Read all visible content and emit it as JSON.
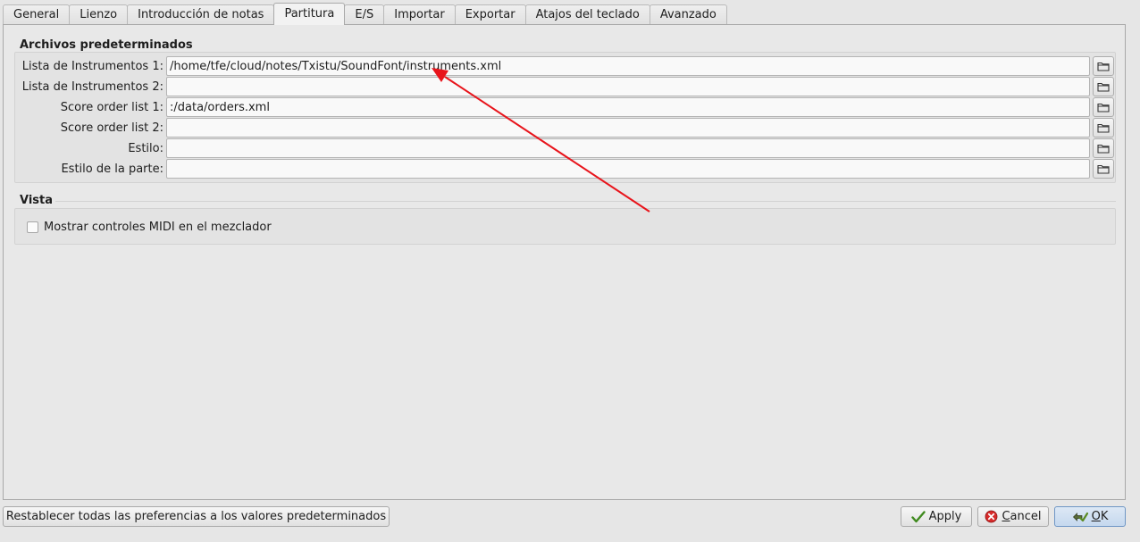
{
  "tabs": [
    {
      "label": "General"
    },
    {
      "label": "Lienzo"
    },
    {
      "label": "Introducción de notas"
    },
    {
      "label": "Partitura",
      "active": true
    },
    {
      "label": "E/S"
    },
    {
      "label": "Importar"
    },
    {
      "label": "Exportar"
    },
    {
      "label": "Atajos del teclado"
    },
    {
      "label": "Avanzado"
    }
  ],
  "default_files": {
    "title": "Archivos predeterminados",
    "rows": [
      {
        "label": "Lista de Instrumentos 1:",
        "value": "/home/tfe/cloud/notes/Txistu/SoundFont/instruments.xml"
      },
      {
        "label": "Lista de Instrumentos 2:",
        "value": ""
      },
      {
        "label": "Score order list 1:",
        "value": ":/data/orders.xml"
      },
      {
        "label": "Score order list 2:",
        "value": ""
      },
      {
        "label": "Estilo:",
        "value": ""
      },
      {
        "label": "Estilo de la parte:",
        "value": ""
      }
    ]
  },
  "view": {
    "title": "Vista",
    "midi_controls_label": "Mostrar controles MIDI en el mezclador",
    "midi_controls_checked": false
  },
  "footer": {
    "reset_label": "Restablecer todas las preferencias a los valores predeterminados",
    "apply_label": "Apply",
    "cancel_first": "C",
    "cancel_rest": "ancel",
    "ok_first": "O",
    "ok_rest": "K"
  },
  "colors": {
    "annotation_arrow": "#e8141b",
    "ok_border": "#6f96c5"
  },
  "icons": {
    "browse": "folder-icon",
    "apply": "checkmark-icon",
    "cancel": "cancel-icon",
    "ok": "ok-icon"
  }
}
